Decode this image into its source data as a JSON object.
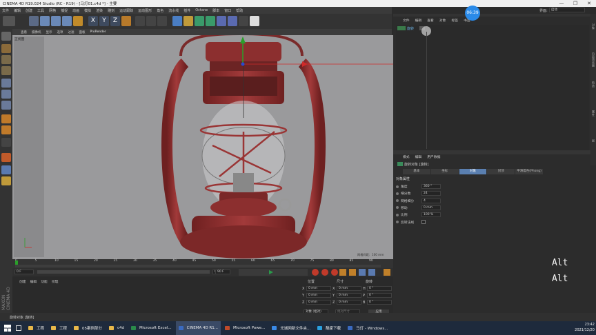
{
  "window": {
    "title": "CINEMA 4D R19.024 Studio (RC - R19) - [马灯01.c4d *] - 主要",
    "controls": [
      "—",
      "❐",
      "✕"
    ]
  },
  "menu": [
    "文件",
    "编辑",
    "创建",
    "工具",
    "网格",
    "捕捉",
    "动画",
    "模拟",
    "渲染",
    "雕刻",
    "运动跟踪",
    "运动图形",
    "角色",
    "流水线",
    "插件",
    "Octane",
    "脚本",
    "窗口",
    "帮助"
  ],
  "viewport": {
    "menu": [
      "查看",
      "摄像机",
      "显示",
      "选项",
      "过滤",
      "面板",
      "ProRender"
    ],
    "label": "正视图",
    "grid_spacing": "网格间距：100 mm"
  },
  "timeline": {
    "ticks": [
      "0",
      "5",
      "10",
      "15",
      "20",
      "25",
      "30",
      "35",
      "40",
      "45",
      "50",
      "55",
      "60",
      "65",
      "70",
      "75",
      "80",
      "85",
      "90"
    ],
    "current": "0 F"
  },
  "transport": {
    "start": "0 F",
    "end": "90 F",
    "end2": "90 F"
  },
  "material_tabs": [
    "创建",
    "编辑",
    "功能",
    "纹理"
  ],
  "coords": {
    "headers": [
      "位置",
      "尺寸",
      "旋转"
    ],
    "rows": [
      {
        "axis": "X",
        "pos": "0 mm",
        "size": "0 mm",
        "rot_axis": "H",
        "rot": "0 °"
      },
      {
        "axis": "Y",
        "pos": "0 mm",
        "size": "0 mm",
        "rot_axis": "P",
        "rot": "0 °"
      },
      {
        "axis": "Z",
        "pos": "0 mm",
        "size": "0 mm",
        "rot_axis": "B",
        "rot": "0 °"
      }
    ],
    "mode": "对象 (相对)",
    "size_mode": "绝对尺寸",
    "apply": "应用"
  },
  "interface": {
    "label": "界面:",
    "value": "启动"
  },
  "object_manager": {
    "tabs": [
      "文件",
      "编辑",
      "查看",
      "对象",
      "标签",
      "书签"
    ],
    "object": "旋转"
  },
  "timer": "06:39",
  "attributes": {
    "menu": [
      "模式",
      "编辑",
      "用户数据"
    ],
    "object": "旋转对象 [旋转]",
    "tabs": [
      "基本",
      "坐标",
      "对象",
      "封顶",
      "平滑着色(Phong)"
    ],
    "active_tab": 2,
    "section": "对象属性",
    "props": [
      {
        "label": "角度",
        "value": "360 °"
      },
      {
        "label": "细分数",
        "value": "24"
      },
      {
        "label": "网格细分",
        "value": "4"
      },
      {
        "label": "移动",
        "value": "0 mm"
      },
      {
        "label": "比例",
        "value": "100 %"
      },
      {
        "label": "反转法线",
        "value": ""
      }
    ]
  },
  "right_side_tabs": [
    "对象",
    "内容浏览器",
    "构造",
    "属性",
    "层"
  ],
  "status": "旋转对象 [旋转]",
  "overlay_keys": [
    "Alt",
    "Alt"
  ],
  "taskbar": {
    "items": [
      "工程",
      "工程",
      "05案例部分",
      "c4d",
      "Microsoft Excel...",
      "CINEMA 4D R1...",
      "Microsoft Powe...",
      "光城网新文件夹...",
      "酷家下载",
      "马灯 - Windows..."
    ],
    "time": "23:42",
    "date": "2021/12/20"
  },
  "maxon": "MAXON CINEMA 4D",
  "colors": {
    "accent": "#5a7fb0",
    "lantern": "#8c2f2f",
    "viewport_bg": "#9a9a9c"
  }
}
